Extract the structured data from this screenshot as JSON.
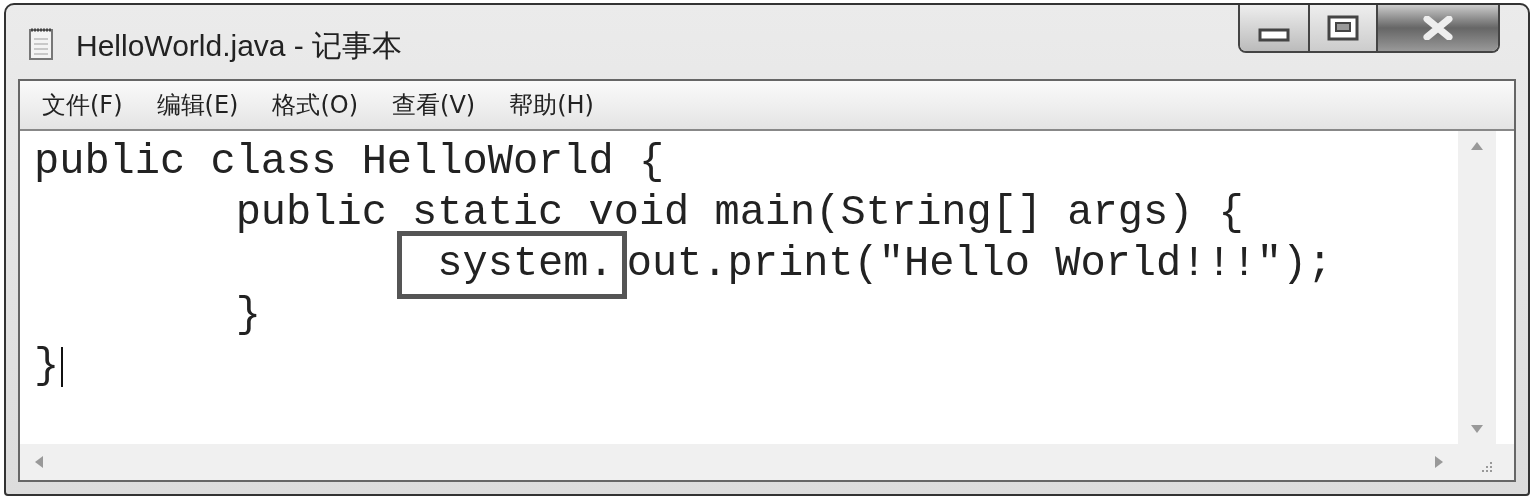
{
  "window": {
    "title": "HelloWorld.java - 记事本"
  },
  "menu": [
    "文件(F)",
    "编辑(E)",
    "格式(O)",
    "查看(V)",
    "帮助(H)"
  ],
  "editor": {
    "lines": [
      {
        "kind": "outer",
        "segments": [
          {
            "text": "public class HelloWorld {",
            "highlighted": false
          }
        ]
      },
      {
        "kind": "nested",
        "segments": [
          {
            "text": "public static void main(String[] args) {",
            "highlighted": false
          }
        ]
      },
      {
        "kind": "deep",
        "segments": [
          {
            "text": "system.",
            "highlighted": true
          },
          {
            "text": "out.print(\"Hello World!!!\");",
            "highlighted": false
          }
        ]
      },
      {
        "kind": "nested",
        "segments": [
          {
            "text": "}",
            "highlighted": false
          }
        ]
      },
      {
        "kind": "outer",
        "segments": [
          {
            "text": "}",
            "highlighted": false
          }
        ],
        "cursor": true
      }
    ]
  }
}
